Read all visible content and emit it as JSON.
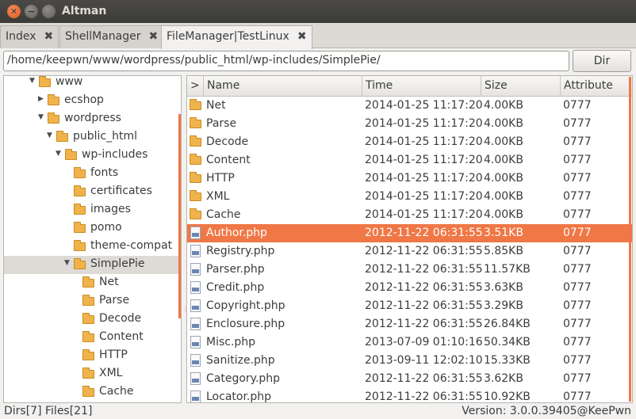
{
  "window": {
    "title": "Altman"
  },
  "tabs": [
    {
      "label": "Index",
      "close": "✖"
    },
    {
      "label": "ShellManager",
      "close": "✖"
    },
    {
      "label": "FileManager|TestLinux",
      "close": "✖"
    }
  ],
  "path": {
    "value": "/home/keepwn/www/wordpress/public_html/wp-includes/SimplePie/"
  },
  "dir_button": "Dir",
  "tree": [
    {
      "label": "www",
      "expanded": true
    },
    {
      "label": "ecshop",
      "expanded": false
    },
    {
      "label": "wordpress",
      "expanded": true
    },
    {
      "label": "public_html",
      "expanded": true
    },
    {
      "label": "wp-includes",
      "expanded": true
    },
    {
      "label": "fonts"
    },
    {
      "label": "certificates"
    },
    {
      "label": "images"
    },
    {
      "label": "pomo"
    },
    {
      "label": "theme-compat"
    },
    {
      "label": "SimplePie",
      "expanded": true,
      "selected": true
    },
    {
      "label": "Net"
    },
    {
      "label": "Parse"
    },
    {
      "label": "Decode"
    },
    {
      "label": "Content"
    },
    {
      "label": "HTTP"
    },
    {
      "label": "XML"
    },
    {
      "label": "Cache"
    }
  ],
  "table": {
    "headers": [
      ">",
      "Name",
      "Time",
      "Size",
      "Attribute"
    ],
    "rows": [
      {
        "type": "folder",
        "name": "Net",
        "time": "2014-01-25 11:17:20",
        "size": "4.00KB",
        "attr": "0777"
      },
      {
        "type": "folder",
        "name": "Parse",
        "time": "2014-01-25 11:17:20",
        "size": "4.00KB",
        "attr": "0777"
      },
      {
        "type": "folder",
        "name": "Decode",
        "time": "2014-01-25 11:17:20",
        "size": "4.00KB",
        "attr": "0777"
      },
      {
        "type": "folder",
        "name": "Content",
        "time": "2014-01-25 11:17:20",
        "size": "4.00KB",
        "attr": "0777"
      },
      {
        "type": "folder",
        "name": "HTTP",
        "time": "2014-01-25 11:17:20",
        "size": "4.00KB",
        "attr": "0777"
      },
      {
        "type": "folder",
        "name": "XML",
        "time": "2014-01-25 11:17:20",
        "size": "4.00KB",
        "attr": "0777"
      },
      {
        "type": "folder",
        "name": "Cache",
        "time": "2014-01-25 11:17:20",
        "size": "4.00KB",
        "attr": "0777"
      },
      {
        "type": "file",
        "name": "Author.php",
        "time": "2012-11-22 06:31:55",
        "size": "3.51KB",
        "attr": "0777",
        "selected": true
      },
      {
        "type": "file",
        "name": "Registry.php",
        "time": "2012-11-22 06:31:55",
        "size": "5.85KB",
        "attr": "0777"
      },
      {
        "type": "file",
        "name": "Parser.php",
        "time": "2012-11-22 06:31:55",
        "size": "11.57KB",
        "attr": "0777"
      },
      {
        "type": "file",
        "name": "Credit.php",
        "time": "2012-11-22 06:31:55",
        "size": "3.63KB",
        "attr": "0777"
      },
      {
        "type": "file",
        "name": "Copyright.php",
        "time": "2012-11-22 06:31:55",
        "size": "3.29KB",
        "attr": "0777"
      },
      {
        "type": "file",
        "name": "Enclosure.php",
        "time": "2012-11-22 06:31:55",
        "size": "26.84KB",
        "attr": "0777"
      },
      {
        "type": "file",
        "name": "Misc.php",
        "time": "2013-07-09 01:10:16",
        "size": "50.34KB",
        "attr": "0777"
      },
      {
        "type": "file",
        "name": "Sanitize.php",
        "time": "2013-09-11 12:02:10",
        "size": "15.33KB",
        "attr": "0777"
      },
      {
        "type": "file",
        "name": "Category.php",
        "time": "2012-11-22 06:31:55",
        "size": "3.62KB",
        "attr": "0777"
      },
      {
        "type": "file",
        "name": "Locator.php",
        "time": "2012-11-22 06:31:55",
        "size": "10.92KB",
        "attr": "0777"
      }
    ]
  },
  "status": {
    "left": "Dirs[7] Files[21]",
    "right": "Version: 3.0.0.39405@KeePwn"
  },
  "colors": {
    "accent": "#f07746",
    "titlebar": "#3c3b37",
    "folder": "#f0b24a"
  }
}
